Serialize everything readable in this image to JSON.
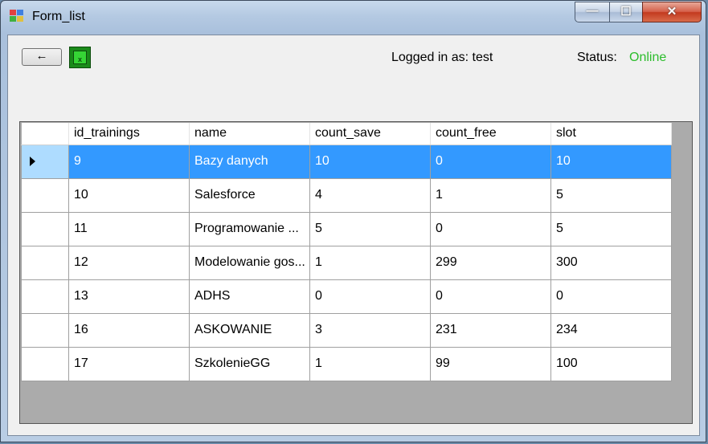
{
  "window": {
    "title": "Form_list",
    "minimize_glyph": "—",
    "maximize_glyph": "☐",
    "close_glyph": "✕"
  },
  "toolbar": {
    "back_label": "←",
    "export_icon": "excel-icon"
  },
  "session": {
    "logged_in_text": "Logged in as: test",
    "status_label": "Status:",
    "status_value": "Online",
    "status_color": "#2cbd2c"
  },
  "grid": {
    "columns": [
      "id_trainings",
      "name",
      "count_save",
      "count_free",
      "slot"
    ],
    "selected_row": 0,
    "selection_color": "#3399ff",
    "rows": [
      [
        "9",
        "Bazy danych",
        "10",
        "0",
        "10"
      ],
      [
        "10",
        "Salesforce",
        "4",
        "1",
        "5"
      ],
      [
        "11",
        "Programowanie ...",
        "5",
        "0",
        "5"
      ],
      [
        "12",
        "Modelowanie gos...",
        "1",
        "299",
        "300"
      ],
      [
        "13",
        "ADHS",
        "0",
        "0",
        "0"
      ],
      [
        "16",
        "ASKOWANIE",
        "3",
        "231",
        "234"
      ],
      [
        "17",
        "SzkolenieGG",
        "1",
        "99",
        "100"
      ]
    ]
  }
}
